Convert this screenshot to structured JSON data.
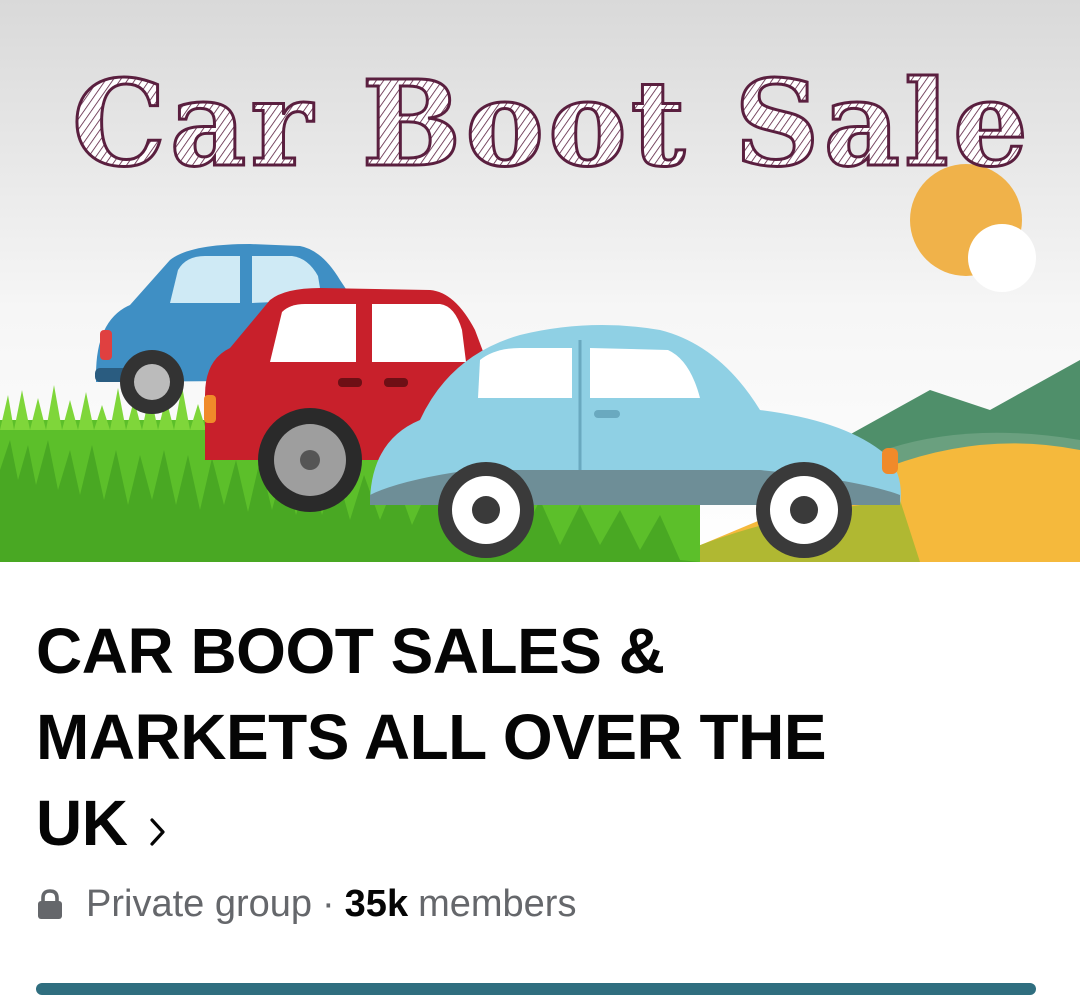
{
  "cover": {
    "headline": "Car Boot Sale",
    "colors": {
      "headline": "#5a1f3f",
      "sky_top": "#dcdcdc",
      "sun": "#f0b24a",
      "grass": "#5cbf2a",
      "car_blue": "#3f8fc4",
      "car_red": "#c8202b",
      "car_lightblue": "#8fd0e4",
      "hill_green": "#4f8f6a",
      "hill_yellow": "#f5b93c"
    }
  },
  "group": {
    "title_lines": [
      "CAR BOOT SALES &",
      "MARKETS ALL OVER THE",
      "UK"
    ],
    "privacy": "Private group",
    "separator": "·",
    "member_count": "35k",
    "member_label": "members",
    "icons": {
      "privacy": "lock-icon",
      "title_arrow": "chevron-right-icon"
    }
  }
}
